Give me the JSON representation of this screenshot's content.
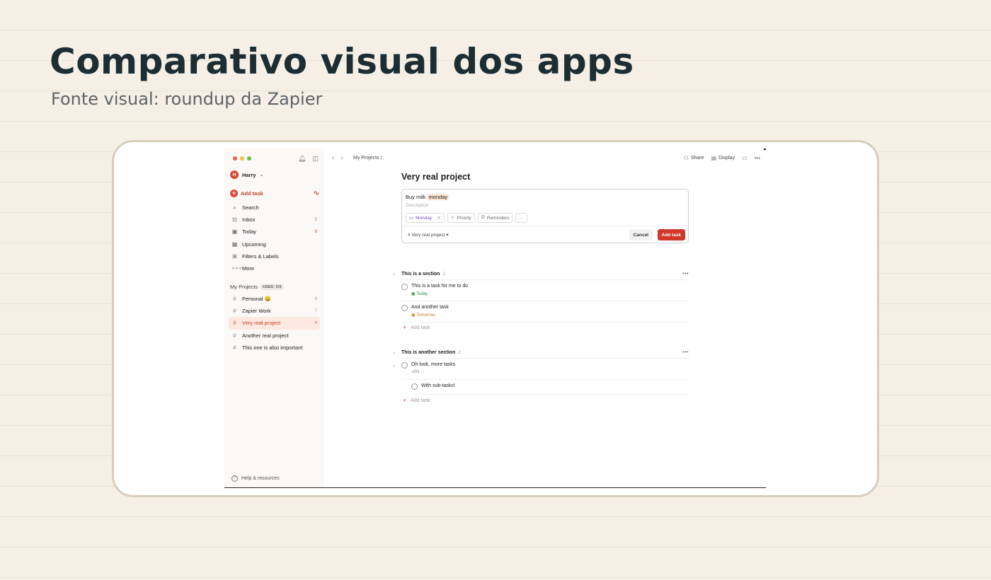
{
  "slide": {
    "title": "Comparativo visual dos apps",
    "subtitle": "Fonte visual: roundup da Zapier"
  },
  "app": {
    "sidebar": {
      "user": {
        "initial": "H",
        "name": "Harry"
      },
      "add_task_label": "Add task",
      "nav": [
        {
          "label": "Search",
          "icon": "search-icon",
          "count": ""
        },
        {
          "label": "Inbox",
          "icon": "inbox-icon",
          "count": "5"
        },
        {
          "label": "Today",
          "icon": "today-icon",
          "count": "9"
        },
        {
          "label": "Upcoming",
          "icon": "calendar-icon",
          "count": ""
        },
        {
          "label": "Filters & Labels",
          "icon": "grid-icon",
          "count": ""
        },
        {
          "label": "More",
          "icon": "more-icon",
          "count": ""
        }
      ],
      "projects_heading": "My Projects",
      "used_badge": "USED: 5/5",
      "projects": [
        {
          "label": "Personal 😀",
          "count": "6"
        },
        {
          "label": "Zapier Work",
          "count": "7"
        },
        {
          "label": "Very real project",
          "count": "4"
        },
        {
          "label": "Another real project",
          "count": ""
        },
        {
          "label": "This one is also important",
          "count": ""
        }
      ],
      "help_label": "Help & resources"
    },
    "topbar": {
      "breadcrumb": "My Projects /",
      "share_label": "Share",
      "display_label": "Display"
    },
    "main": {
      "title": "Very real project",
      "editor": {
        "task_text": "Buy milk",
        "task_highlight": "monday",
        "description_placeholder": "Description",
        "date_chip": "Monday",
        "priority_chip": "Priority",
        "reminders_chip": "Reminders",
        "more_chip": "···",
        "project_select": "Very real project",
        "cancel_label": "Cancel",
        "add_label": "Add task"
      },
      "sections": [
        {
          "name": "This is a section",
          "count": "2",
          "tasks": [
            {
              "name": "This is a task for me to do",
              "due": "Today"
            },
            {
              "name": "And another task",
              "due": "Tomorrow"
            }
          ],
          "add_label": "Add task"
        },
        {
          "name": "This is another section",
          "count": "2",
          "tasks": [
            {
              "name": "Oh look, more tasks",
              "sub": "0/1"
            },
            {
              "name": "With sub-tasks!"
            }
          ],
          "add_label": "Add task"
        }
      ]
    },
    "colors": {
      "accent": "#dc4c3e",
      "active_bg": "#fde9e0"
    }
  }
}
